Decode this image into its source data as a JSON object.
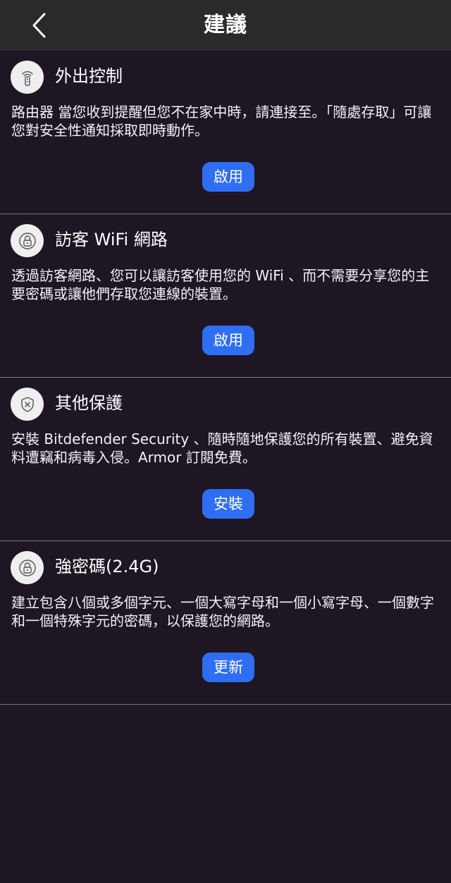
{
  "header": {
    "title": "建議",
    "back_icon": "chevron-left-icon"
  },
  "colors": {
    "background": "#1e1623",
    "header": "#2a2a2b",
    "accent": "#2e6ef2",
    "divider": "#7a7480",
    "icon_circle": "#efeef0"
  },
  "cards": [
    {
      "icon": "remote-control-icon",
      "title": "外出控制",
      "description": "路由器 當您收到提醒但您不在家中時，請連接至。「隨處存取」可讓您對安全性通知採取即時動作。",
      "button_label": "啟用"
    },
    {
      "icon": "lock-icon",
      "title": "訪客 WiFi 網路",
      "description": "透過訪客網路、您可以讓訪客使用您的 WiFi 、而不需要分享您的主要密碼或讓他們存取您連線的裝置。",
      "button_label": "啟用"
    },
    {
      "icon": "shield-x-icon",
      "title": "其他保護",
      "description": "安裝 Bitdefender Security 、隨時隨地保護您的所有裝置、避免資料遭竊和病毒入侵。Armor 訂閱免費。",
      "button_label": "安裝"
    },
    {
      "icon": "lock-icon",
      "title": "強密碼(2.4G)",
      "description": "建立包含八個或多個字元、一個大寫字母和一個小寫字母、一個數字和一個特殊字元的密碼，以保護您的網路。",
      "button_label": "更新"
    }
  ]
}
